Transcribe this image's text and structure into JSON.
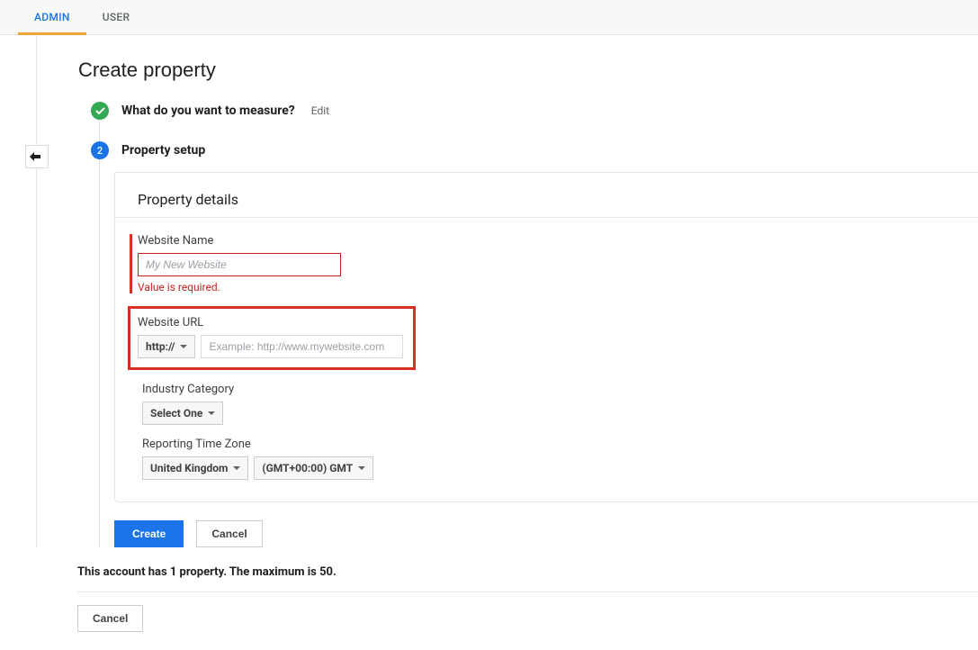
{
  "tabs": {
    "admin": "ADMIN",
    "user": "USER"
  },
  "page": {
    "title": "Create property"
  },
  "steps": {
    "step1": {
      "title": "What do you want to measure?",
      "edit": "Edit"
    },
    "step2": {
      "title": "Property setup",
      "number": "2"
    }
  },
  "details": {
    "heading": "Property details",
    "website_name": {
      "label": "Website Name",
      "placeholder": "My New Website",
      "error": "Value is required."
    },
    "website_url": {
      "label": "Website URL",
      "protocol": "http://",
      "placeholder": "Example: http://www.mywebsite.com"
    },
    "industry": {
      "label": "Industry Category",
      "selected": "Select One"
    },
    "timezone": {
      "label": "Reporting Time Zone",
      "country": "United Kingdom",
      "zone": "(GMT+00:00) GMT"
    }
  },
  "buttons": {
    "create": "Create",
    "cancel": "Cancel"
  },
  "account_limit": "This account has 1 property. The maximum is 50.",
  "bottom_cancel": "Cancel"
}
